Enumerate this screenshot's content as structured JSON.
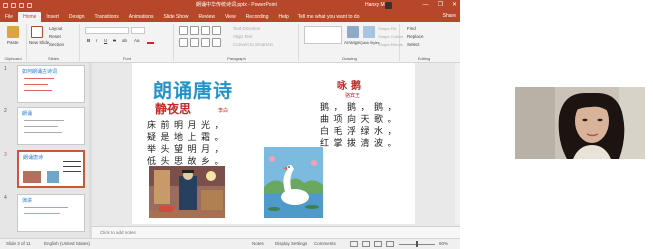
{
  "titlebar": {
    "document_title": "朗诵中华传统诗词.pptx  -  PowerPoint",
    "user": "Hanxy Min",
    "minimize_glyph": "—",
    "restore_glyph": "❐",
    "close_glyph": "✕"
  },
  "tabs": [
    "File",
    "Home",
    "Insert",
    "Design",
    "Transitions",
    "Animations",
    "Slide Show",
    "Review",
    "View",
    "Recording",
    "Help"
  ],
  "active_tab": "Home",
  "tell_me": "Tell me what you want to do",
  "share_label": "Share",
  "ribbon": {
    "clipboard": {
      "label": "Clipboard",
      "paste": "Paste"
    },
    "slides": {
      "label": "Slides",
      "new_slide": "New Slide",
      "layout": "Layout",
      "reset": "Reset",
      "section": "Section"
    },
    "font": {
      "label": "Font",
      "bold": "B",
      "italic": "I",
      "underline": "U",
      "strike": "S",
      "shadow": "ab",
      "case": "Aa"
    },
    "paragraph": {
      "label": "Paragraph",
      "text_direction": "Text Direction",
      "align_text": "Align Text",
      "convert_smartart": "Convert to SmartArt"
    },
    "drawing": {
      "label": "Drawing",
      "arrange": "Arrange",
      "quick_styles": "Quick Styles",
      "shape_fill": "Shape Fill",
      "shape_outline": "Shape Outline",
      "shape_effects": "Shape Effects"
    },
    "editing": {
      "label": "Editing",
      "find": "Find",
      "replace": "Replace",
      "select": "Select"
    }
  },
  "thumbnails": [
    {
      "number": "1",
      "title": "如何朗诵古诗词"
    },
    {
      "number": "2",
      "title": "朗诵"
    },
    {
      "number": "3",
      "title": "朗诵唐诗"
    },
    {
      "number": "4",
      "title": "演讲"
    }
  ],
  "selected_slide": "3",
  "slide": {
    "title": "朗诵唐诗",
    "poem1": {
      "title": "静夜思",
      "author": "李白",
      "lines": [
        "床前明月光，",
        "疑是地上霜。",
        "举头望明月，",
        "低头思故乡。"
      ]
    },
    "poem2": {
      "title": "咏鹅",
      "author": "骆宾王",
      "lines": [
        "鹅，鹅，鹅，",
        "曲项向天歌。",
        "白毛浮绿水，",
        "红掌拨清波。"
      ]
    }
  },
  "notes_placeholder": "Click to add notes",
  "statusbar": {
    "slide_info": "Slide 3 of 11",
    "language": "English (United States)",
    "notes": "Notes",
    "display_settings": "Display Settings",
    "comments": "Comments",
    "zoom": "60%"
  },
  "colors": {
    "accent": "#b7472a",
    "slide_title": "#2592c9",
    "poem_title": "#c0282b"
  }
}
